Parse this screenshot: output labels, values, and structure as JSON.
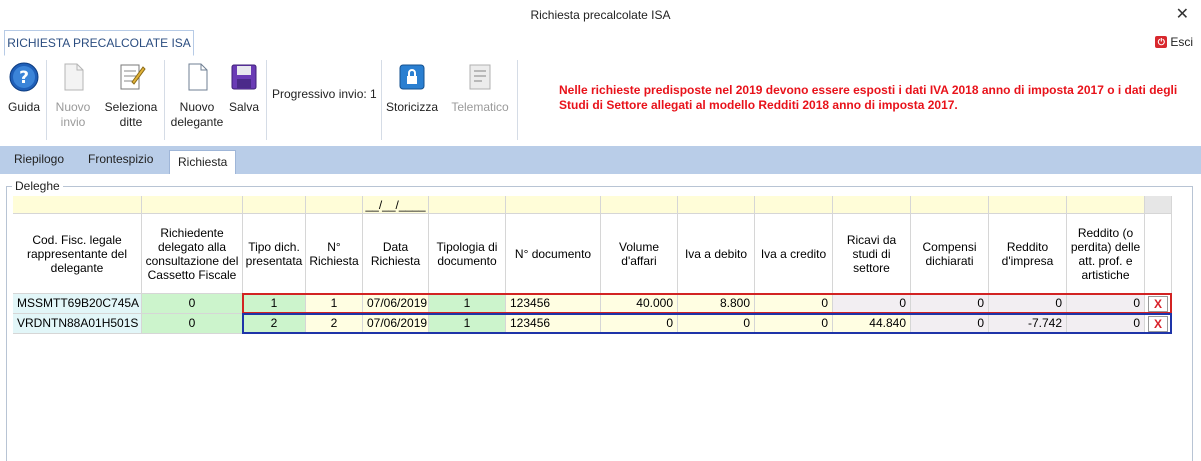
{
  "window": {
    "title": "Richiesta precalcolate ISA",
    "close_glyph": "✕"
  },
  "ribbon": {
    "tab_label": "RICHIESTA PRECALCOLATE ISA",
    "exit_label": "Esci",
    "buttons": {
      "guida": "Guida",
      "nuovo_invio_1": "Nuovo",
      "nuovo_invio_2": "invio",
      "seleziona_1": "Seleziona",
      "seleziona_2": "ditte",
      "nuovo_delegante_1": "Nuovo",
      "nuovo_delegante_2": "delegante",
      "salva": "Salva",
      "storicizza": "Storicizza",
      "telematico": "Telematico"
    },
    "progressivo": "Progressivo invio: 1",
    "warning": "Nelle richieste predisposte nel 2019 devono essere esposti i dati IVA 2018 anno di imposta 2017 o i dati degli Studi di Settore allegati al modello Redditi 2018 anno di imposta 2017."
  },
  "sheet_tabs": [
    "Riepilogo",
    "Frontespizio",
    "Richiesta"
  ],
  "group_label": "Deleghe",
  "table": {
    "filter_date": "__/__/____",
    "headers": [
      "Cod. Fisc. legale rappresentante del delegante",
      "Richiedente delegato alla consultazione del Cassetto Fiscale",
      "Tipo dich. presentata",
      "N° Richiesta",
      "Data Richiesta",
      "Tipologia di documento",
      "N° documento",
      "Volume d'affari",
      "Iva a debito",
      "Iva a credito",
      "Ricavi da studi di settore",
      "Compensi dichiarati",
      "Reddito d'impresa",
      "Reddito (o perdita) delle att. prof. e artistiche"
    ],
    "rows": [
      [
        "MSSMTT69B20C745A",
        "0",
        "1",
        "1",
        "07/06/2019",
        "1",
        "123456",
        "40.000",
        "8.800",
        "0",
        "0",
        "0",
        "0",
        "0"
      ],
      [
        "VRDNTN88A01H501S",
        "0",
        "2",
        "2",
        "07/06/2019",
        "1",
        "123456",
        "0",
        "0",
        "0",
        "44.840",
        "0",
        "-7.742",
        "0"
      ]
    ],
    "delete_glyph": "X"
  },
  "colors": {
    "warning": "#e8121a",
    "highlight_row1": "#d22323",
    "highlight_row2": "#1e34a8"
  }
}
